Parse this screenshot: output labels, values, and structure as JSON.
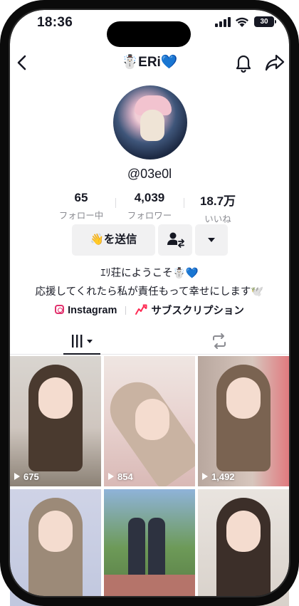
{
  "status_bar": {
    "time": "18:36",
    "battery": "30"
  },
  "profile": {
    "display_name": "☃️ERi💙",
    "handle": "@03e0l",
    "stats": [
      {
        "value": "65",
        "label": "フォロー中"
      },
      {
        "value": "4,039",
        "label": "フォロワー"
      },
      {
        "value": "18.7万",
        "label": "いいね"
      }
    ],
    "actions": {
      "message_label": "👋を送信"
    },
    "bio_lines": [
      "ｴﾘ荘にようこそ☃️💙",
      "応援してくれたら私が責任もって幸せにします🕊️"
    ],
    "links": {
      "instagram_label": "Instagram",
      "subscription_label": "サブスクリプション"
    }
  },
  "videos": [
    {
      "views": "675"
    },
    {
      "views": "854"
    },
    {
      "views": "1,492"
    },
    {
      "views": ""
    },
    {
      "views": ""
    },
    {
      "views": ""
    }
  ],
  "colors": {
    "accent_pink": "#fe2c55",
    "instagram": "#e1306c",
    "text": "#161823",
    "muted": "#8a8b91"
  }
}
